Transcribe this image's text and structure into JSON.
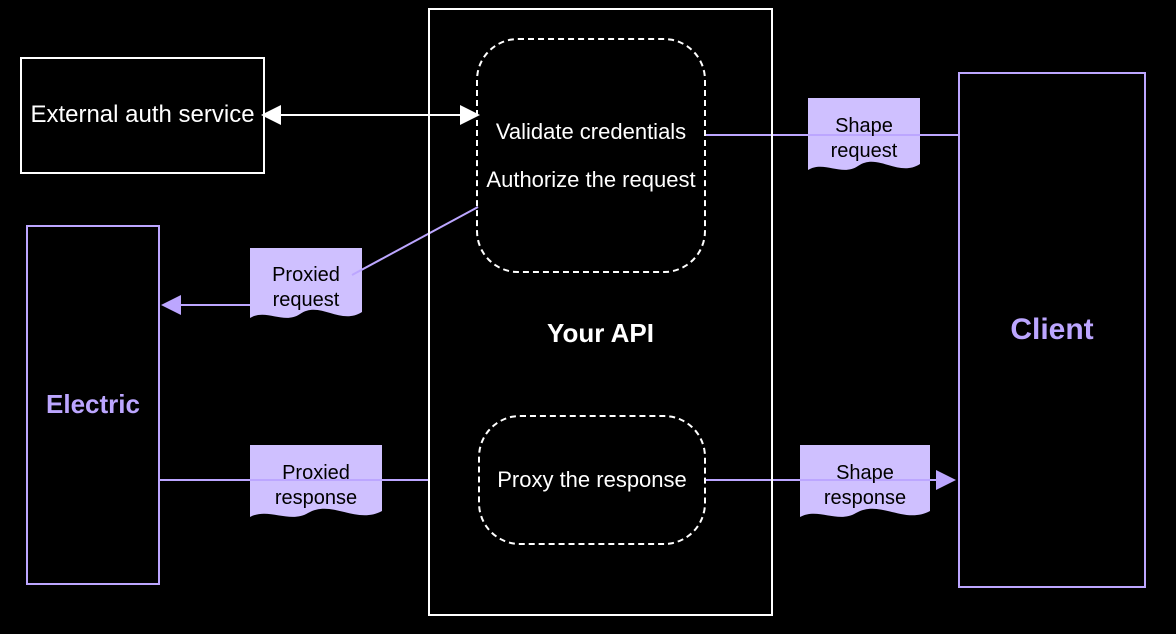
{
  "diagram": {
    "nodes": {
      "external_auth": "External auth service",
      "electric": "Electric",
      "your_api_title": "Your API",
      "validate_credentials": "Validate credentials",
      "authorize_request": "Authorize the request",
      "proxy_response": "Proxy the response",
      "client": "Client"
    },
    "edges": {
      "proxied_request": "Proxied request",
      "proxied_response": "Proxied response",
      "shape_request": "Shape request",
      "shape_response": "Shape response"
    },
    "colors": {
      "accent": "#bca6ff",
      "note_fill": "#cfc0ff",
      "foreground": "#ffffff",
      "background": "#000000"
    }
  }
}
